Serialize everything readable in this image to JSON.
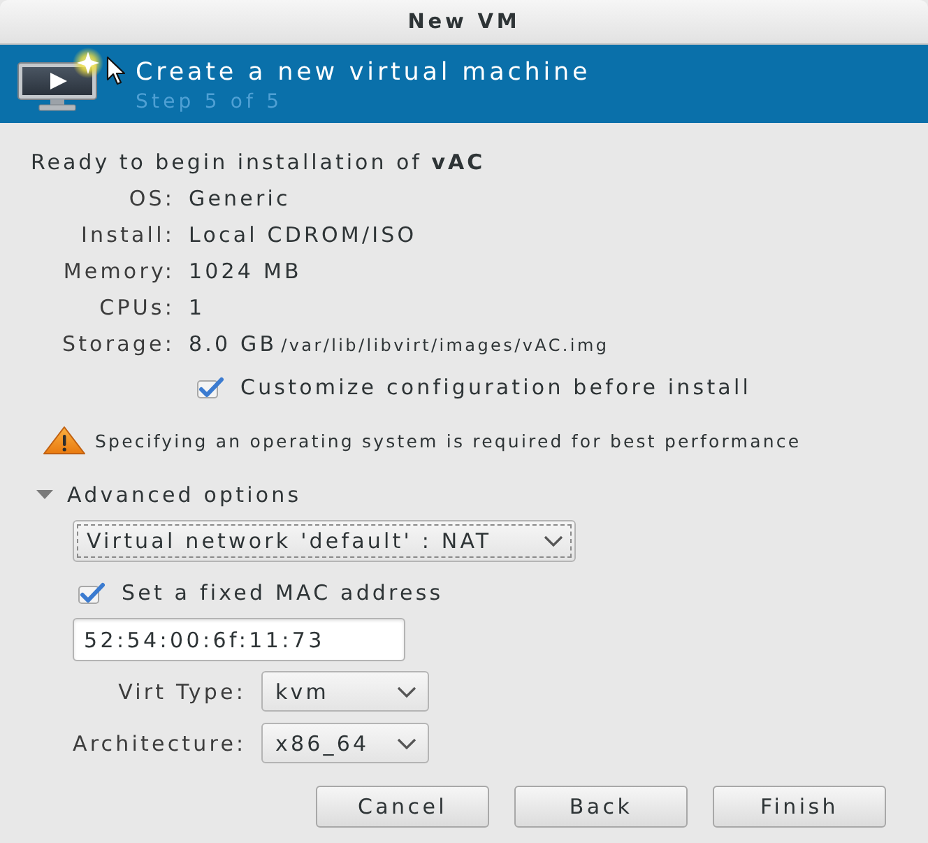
{
  "window": {
    "title": "New VM"
  },
  "header": {
    "title": "Create a new virtual machine",
    "subtitle": "Step 5 of 5"
  },
  "summary": {
    "heading": "Ready to begin installation of **vAC**",
    "fields": [
      {
        "label": "OS:",
        "value": "Generic"
      },
      {
        "label": "Install:",
        "value": "Local CDROM/ISO"
      },
      {
        "label": "Memory:",
        "value": "1024 MB"
      },
      {
        "label": "CPUs:",
        "value": "1"
      },
      {
        "label": "Storage:",
        "value": "8.0 GB",
        "detail": "/var/lib/libvirt/images/vAC.img"
      }
    ]
  },
  "customize": {
    "label": "Customize configuration before install",
    "checked": true
  },
  "warning": {
    "text": "Specifying an operating system is required for best performance"
  },
  "advanced": {
    "label": "Advanced options",
    "expanded": true,
    "network": {
      "value": "Virtual network 'default' : NAT",
      "focused": true
    },
    "fixed_mac": {
      "label": "Set a fixed MAC address",
      "checked": true
    },
    "mac_address": {
      "value": "52:54:00:6f:11:73"
    },
    "selects": [
      {
        "label": "Virt Type:",
        "value": "kvm"
      },
      {
        "label": "Architecture:",
        "value": "x86_64"
      }
    ]
  },
  "buttons": [
    {
      "label": "Cancel"
    },
    {
      "label": "Back"
    },
    {
      "label": "Finish"
    }
  ]
}
